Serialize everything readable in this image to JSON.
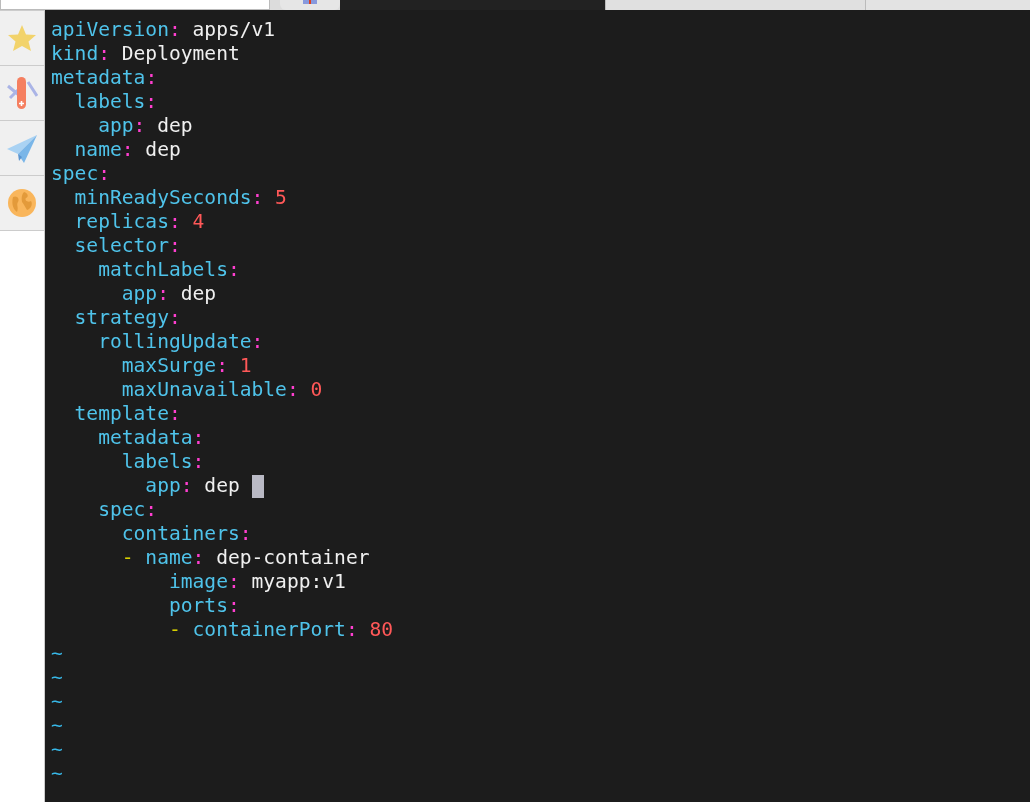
{
  "editor": {
    "lines": [
      {
        "key": "apiVersion:",
        "value": "apps/v1",
        "kind": "string"
      },
      {
        "key": "kind:",
        "value": "Deployment",
        "kind": "string"
      },
      {
        "key": "metadata:",
        "children": [
          {
            "key": "labels:",
            "children": [
              {
                "key": "app:",
                "value": "dep",
                "kind": "string"
              }
            ]
          },
          {
            "key": "name:",
            "value": "dep",
            "kind": "string"
          }
        ]
      },
      {
        "key": "spec:",
        "children": [
          {
            "key": "minReadySeconds:",
            "value": "5",
            "kind": "number"
          },
          {
            "key": "replicas:",
            "value": "4",
            "kind": "number"
          },
          {
            "key": "selector:",
            "children": [
              {
                "key": "matchLabels:",
                "children": [
                  {
                    "key": "app:",
                    "value": "dep",
                    "kind": "string"
                  }
                ]
              }
            ]
          },
          {
            "key": "strategy:",
            "children": [
              {
                "key": "rollingUpdate:",
                "children": [
                  {
                    "key": "maxSurge:",
                    "value": "1",
                    "kind": "number"
                  },
                  {
                    "key": "maxUnavailable:",
                    "value": "0",
                    "kind": "number"
                  }
                ]
              }
            ]
          },
          {
            "key": "template:",
            "children": [
              {
                "key": "metadata:",
                "children": [
                  {
                    "key": "labels:",
                    "children": [
                      {
                        "key": "app:",
                        "value": "dep",
                        "kind": "string",
                        "cursor": true
                      }
                    ]
                  }
                ]
              },
              {
                "key": "spec:",
                "children": [
                  {
                    "key": "containers:",
                    "children": [
                      {
                        "dash": "-",
                        "key": "name:",
                        "value": "dep-container",
                        "kind": "string",
                        "children": [
                          {
                            "key": "image:",
                            "value": "myapp:v1",
                            "kind": "string"
                          },
                          {
                            "key": "ports:",
                            "children": [
                              {
                                "dash": "-",
                                "key": "containerPort:",
                                "value": "80",
                                "kind": "number"
                              }
                            ]
                          }
                        ]
                      }
                    ]
                  }
                ]
              }
            ]
          }
        ]
      }
    ],
    "empty_lines": [
      "~",
      "~",
      "~",
      "~",
      "~",
      "~"
    ]
  }
}
